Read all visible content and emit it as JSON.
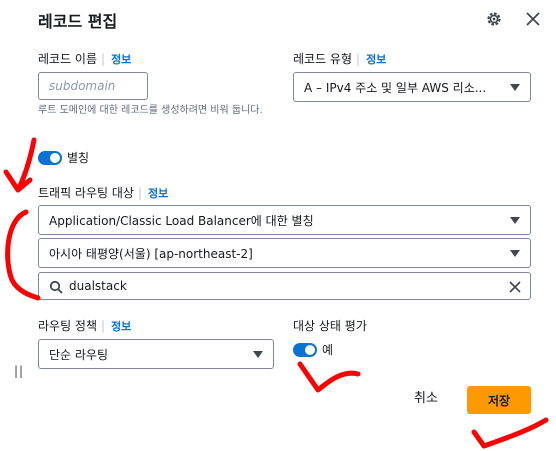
{
  "modal": {
    "title": "레코드 편집"
  },
  "record_name": {
    "label": "레코드 이름",
    "info": "정보",
    "placeholder": "subdomain",
    "help": "루트 도메인에 대한 레코드를 생성하려면 비워 둡니다."
  },
  "record_type": {
    "label": "레코드 유형",
    "info": "정보",
    "value": "A – IPv4 주소 및 일부 AWS 리소..."
  },
  "alias": {
    "label": "별칭",
    "enabled": true
  },
  "traffic_target": {
    "label": "트래픽 라우팅 대상",
    "info": "정보",
    "endpoint_value": "Application/Classic Load Balancer에 대한 별칭",
    "region_value": "아시아 태평양(서울) [ap-northeast-2]",
    "search_value": "dualstack"
  },
  "routing_policy": {
    "label": "라우팅 정책",
    "info": "정보",
    "value": "단순 라우팅"
  },
  "health_eval": {
    "label": "대상 상태 평가",
    "toggle_label": "예",
    "enabled": true
  },
  "footer": {
    "cancel_label": "취소",
    "save_label": "저장"
  },
  "handle": {
    "glyph": "||"
  },
  "colors": {
    "accent": "#0972d3",
    "primary_button": "#ff9900",
    "annotation": "#ff0000"
  },
  "icons": [
    "gear-icon",
    "close-icon",
    "search-icon",
    "clear-icon",
    "caret-down-icon"
  ]
}
